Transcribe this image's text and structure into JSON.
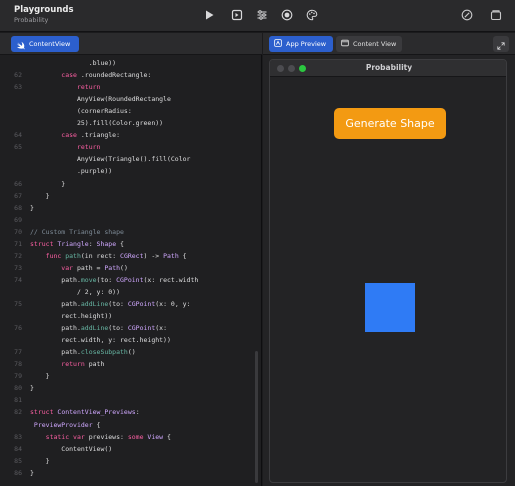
{
  "app": {
    "title": "Playgrounds",
    "subtitle": "Probability"
  },
  "toolbar": {
    "icons": [
      "play-icon",
      "step-icon",
      "sliders-icon",
      "record-icon",
      "palette-icon",
      "check-circle-icon",
      "library-icon"
    ]
  },
  "editor": {
    "tab_label": "ContentView",
    "lines": [
      {
        "n": "",
        "t": [
          [
            "tx",
            "               .blue))"
          ]
        ]
      },
      {
        "n": "62",
        "t": [
          [
            "kw",
            "        case "
          ],
          [
            "tx",
            ".roundedRectangle:"
          ]
        ]
      },
      {
        "n": "63",
        "t": [
          [
            "kw",
            "            return"
          ]
        ]
      },
      {
        "n": "",
        "t": [
          [
            "tx",
            "            AnyView(RoundedRectangle"
          ]
        ]
      },
      {
        "n": "",
        "t": [
          [
            "tx",
            "            (cornerRadius:"
          ]
        ]
      },
      {
        "n": "",
        "t": [
          [
            "tx",
            "            25).fill(Color.green))"
          ]
        ]
      },
      {
        "n": "64",
        "t": [
          [
            "kw",
            "        case "
          ],
          [
            "tx",
            ".triangle:"
          ]
        ]
      },
      {
        "n": "65",
        "t": [
          [
            "kw",
            "            return"
          ]
        ]
      },
      {
        "n": "",
        "t": [
          [
            "tx",
            "            AnyView(Triangle().fill(Color"
          ]
        ]
      },
      {
        "n": "",
        "t": [
          [
            "tx",
            "            .purple))"
          ]
        ]
      },
      {
        "n": "66",
        "t": [
          [
            "tx",
            "        }"
          ]
        ]
      },
      {
        "n": "67",
        "t": [
          [
            "tx",
            "    }"
          ]
        ]
      },
      {
        "n": "68",
        "t": [
          [
            "tx",
            "}"
          ]
        ]
      },
      {
        "n": "69",
        "t": [
          [
            "tx",
            ""
          ]
        ]
      },
      {
        "n": "70",
        "t": [
          [
            "cm",
            "// Custom Triangle shape"
          ]
        ]
      },
      {
        "n": "71",
        "t": [
          [
            "kw",
            "struct "
          ],
          [
            "ty",
            "Triangle"
          ],
          [
            "tx",
            ": "
          ],
          [
            "ty",
            "Shape"
          ],
          [
            "tx",
            " {"
          ]
        ]
      },
      {
        "n": "72",
        "t": [
          [
            "kw",
            "    func "
          ],
          [
            "fn",
            "path"
          ],
          [
            "tx",
            "(in rect: "
          ],
          [
            "ty",
            "CGRect"
          ],
          [
            "tx",
            ") -> "
          ],
          [
            "ty",
            "Path"
          ],
          [
            "tx",
            " {"
          ]
        ]
      },
      {
        "n": "73",
        "t": [
          [
            "kw",
            "        var "
          ],
          [
            "tx",
            "path = "
          ],
          [
            "ty",
            "Path"
          ],
          [
            "tx",
            "()"
          ]
        ]
      },
      {
        "n": "74",
        "t": [
          [
            "tx",
            "        path."
          ],
          [
            "fn",
            "move"
          ],
          [
            "tx",
            "(to: "
          ],
          [
            "ty",
            "CGPoint"
          ],
          [
            "tx",
            "(x: rect.width"
          ]
        ]
      },
      {
        "n": "",
        "t": [
          [
            "tx",
            "            / 2, y: 0))"
          ]
        ]
      },
      {
        "n": "75",
        "t": [
          [
            "tx",
            "        path."
          ],
          [
            "fn",
            "addLine"
          ],
          [
            "tx",
            "(to: "
          ],
          [
            "ty",
            "CGPoint"
          ],
          [
            "tx",
            "(x: 0, y:"
          ]
        ]
      },
      {
        "n": "",
        "t": [
          [
            "tx",
            "        rect.height))"
          ]
        ]
      },
      {
        "n": "76",
        "t": [
          [
            "tx",
            "        path."
          ],
          [
            "fn",
            "addLine"
          ],
          [
            "tx",
            "(to: "
          ],
          [
            "ty",
            "CGPoint"
          ],
          [
            "tx",
            "(x:"
          ]
        ]
      },
      {
        "n": "",
        "t": [
          [
            "tx",
            "        rect.width, y: rect.height))"
          ]
        ]
      },
      {
        "n": "77",
        "t": [
          [
            "tx",
            "        path."
          ],
          [
            "fn",
            "closeSubpath"
          ],
          [
            "tx",
            "()"
          ]
        ]
      },
      {
        "n": "78",
        "t": [
          [
            "kw",
            "        return "
          ],
          [
            "tx",
            "path"
          ]
        ]
      },
      {
        "n": "79",
        "t": [
          [
            "tx",
            "    }"
          ]
        ]
      },
      {
        "n": "80",
        "t": [
          [
            "tx",
            "}"
          ]
        ]
      },
      {
        "n": "81",
        "t": [
          [
            "tx",
            ""
          ]
        ]
      },
      {
        "n": "82",
        "t": [
          [
            "kw",
            "struct "
          ],
          [
            "ty",
            "ContentView_Previews"
          ],
          [
            "tx",
            ":"
          ]
        ]
      },
      {
        "n": "",
        "t": [
          [
            "ty",
            " PreviewProvider"
          ],
          [
            "tx",
            " {"
          ]
        ]
      },
      {
        "n": "83",
        "t": [
          [
            "kw",
            "    static var "
          ],
          [
            "tx",
            "previews: "
          ],
          [
            "kw",
            "some "
          ],
          [
            "ty",
            "View"
          ],
          [
            "tx",
            " {"
          ]
        ]
      },
      {
        "n": "84",
        "t": [
          [
            "tx",
            "        ContentView()"
          ]
        ]
      },
      {
        "n": "85",
        "t": [
          [
            "tx",
            "    }"
          ]
        ]
      },
      {
        "n": "86",
        "t": [
          [
            "tx",
            "}"
          ]
        ]
      }
    ]
  },
  "preview": {
    "tabs": [
      {
        "label": "App Preview",
        "active": true
      },
      {
        "label": "Content View",
        "active": false
      }
    ],
    "window_title": "Probability",
    "button_label": "Generate Shape",
    "shape_color": "#2f7bf5",
    "button_color": "#f39a12"
  }
}
